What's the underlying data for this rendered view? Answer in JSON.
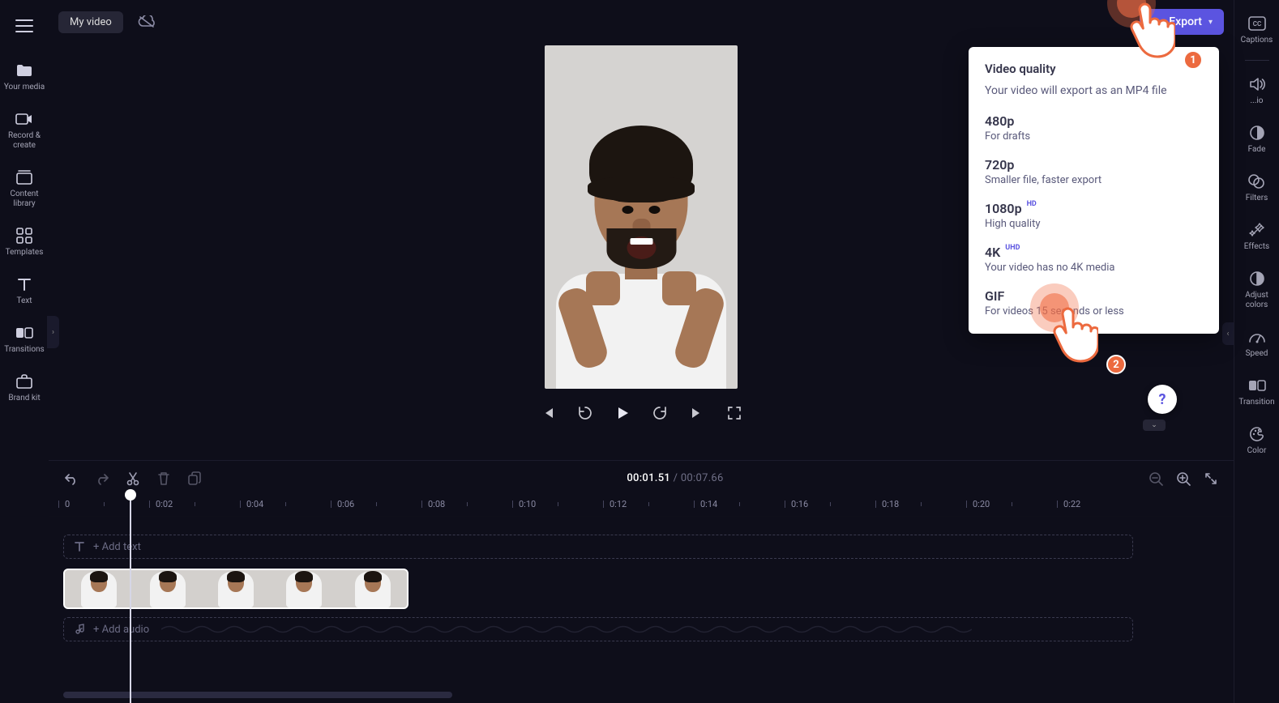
{
  "header": {
    "title": "My video",
    "export_label": "Export"
  },
  "left_sidebar": [
    {
      "id": "your-media",
      "label": "Your media"
    },
    {
      "id": "record-create",
      "label": "Record & create"
    },
    {
      "id": "content-library",
      "label": "Content library"
    },
    {
      "id": "templates",
      "label": "Templates"
    },
    {
      "id": "text",
      "label": "Text"
    },
    {
      "id": "transitions",
      "label": "Transitions"
    },
    {
      "id": "brand-kit",
      "label": "Brand kit"
    }
  ],
  "right_sidebar": [
    {
      "id": "captions",
      "label": "Captions"
    },
    {
      "id": "audio",
      "label": "...io"
    },
    {
      "id": "fade",
      "label": "Fade"
    },
    {
      "id": "filters",
      "label": "Filters"
    },
    {
      "id": "effects",
      "label": "Effects"
    },
    {
      "id": "adjust-colors",
      "label": "Adjust colors"
    },
    {
      "id": "speed",
      "label": "Speed"
    },
    {
      "id": "transition",
      "label": "Transition"
    },
    {
      "id": "color",
      "label": "Color"
    }
  ],
  "export_panel": {
    "heading": "Video quality",
    "subheading": "Your video will export as an MP4 file",
    "options": [
      {
        "name": "480p",
        "desc": "For drafts",
        "badge": ""
      },
      {
        "name": "720p",
        "desc": "Smaller file, faster export",
        "badge": ""
      },
      {
        "name": "1080p",
        "desc": "High quality",
        "badge": "HD"
      },
      {
        "name": "4K",
        "desc": "Your video has no 4K media",
        "badge": "UHD"
      },
      {
        "name": "GIF",
        "desc": "For videos 15 seconds or less",
        "badge": ""
      }
    ]
  },
  "playback": {
    "current_time": "00:01.51",
    "separator": " / ",
    "total_time": "00:07.66"
  },
  "ruler_ticks": [
    "0",
    "0:02",
    "0:04",
    "0:06",
    "0:08",
    "0:10",
    "0:12",
    "0:14",
    "0:16",
    "0:18",
    "0:20",
    "0:22"
  ],
  "tracks": {
    "text_placeholder": "+ Add text",
    "audio_placeholder": "+ Add audio"
  },
  "annotations": {
    "hand1": "1",
    "hand2": "2"
  },
  "help": "?"
}
